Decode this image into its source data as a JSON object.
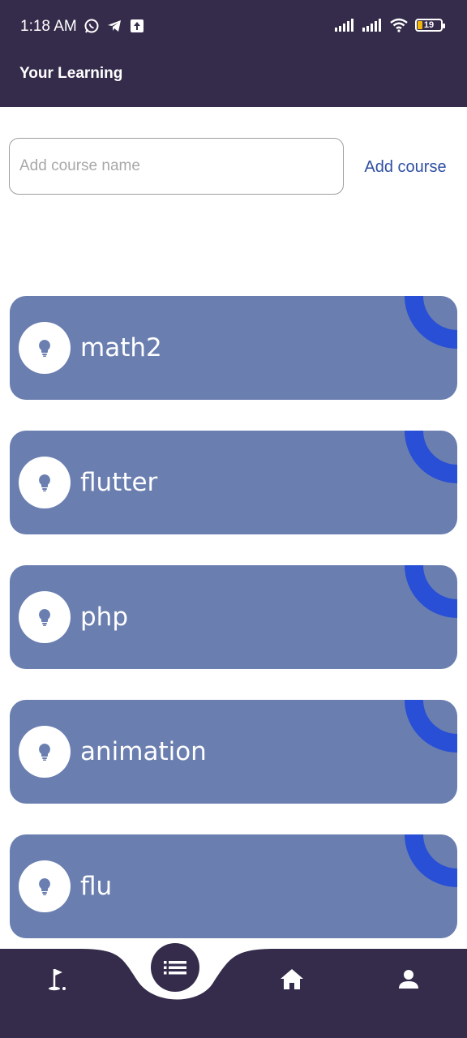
{
  "status_bar": {
    "time": "1:18 AM",
    "battery": "19",
    "icons": [
      "whatsapp-icon",
      "telegram-icon",
      "upload-icon",
      "signal-icon",
      "signal-icon",
      "wifi-icon",
      "battery-icon"
    ]
  },
  "app_bar": {
    "title": "Your Learning"
  },
  "add_course": {
    "placeholder": "Add course name",
    "value": "",
    "button_label": "Add course"
  },
  "courses": [
    {
      "name": "math2",
      "icon": "lightbulb-icon"
    },
    {
      "name": "flutter",
      "icon": "lightbulb-icon"
    },
    {
      "name": "php",
      "icon": "lightbulb-icon"
    },
    {
      "name": "animation",
      "icon": "lightbulb-icon"
    },
    {
      "name": "flu",
      "icon": "lightbulb-icon"
    }
  ],
  "bottom_nav": {
    "items": [
      "golf-flag-icon",
      "list-icon",
      "home-icon",
      "person-icon"
    ],
    "active": "list-icon"
  },
  "colors": {
    "bar": "#352c4c",
    "card": "#6a7eb0",
    "ring": "#284fd5",
    "accent_text": "#2f4fa3"
  }
}
